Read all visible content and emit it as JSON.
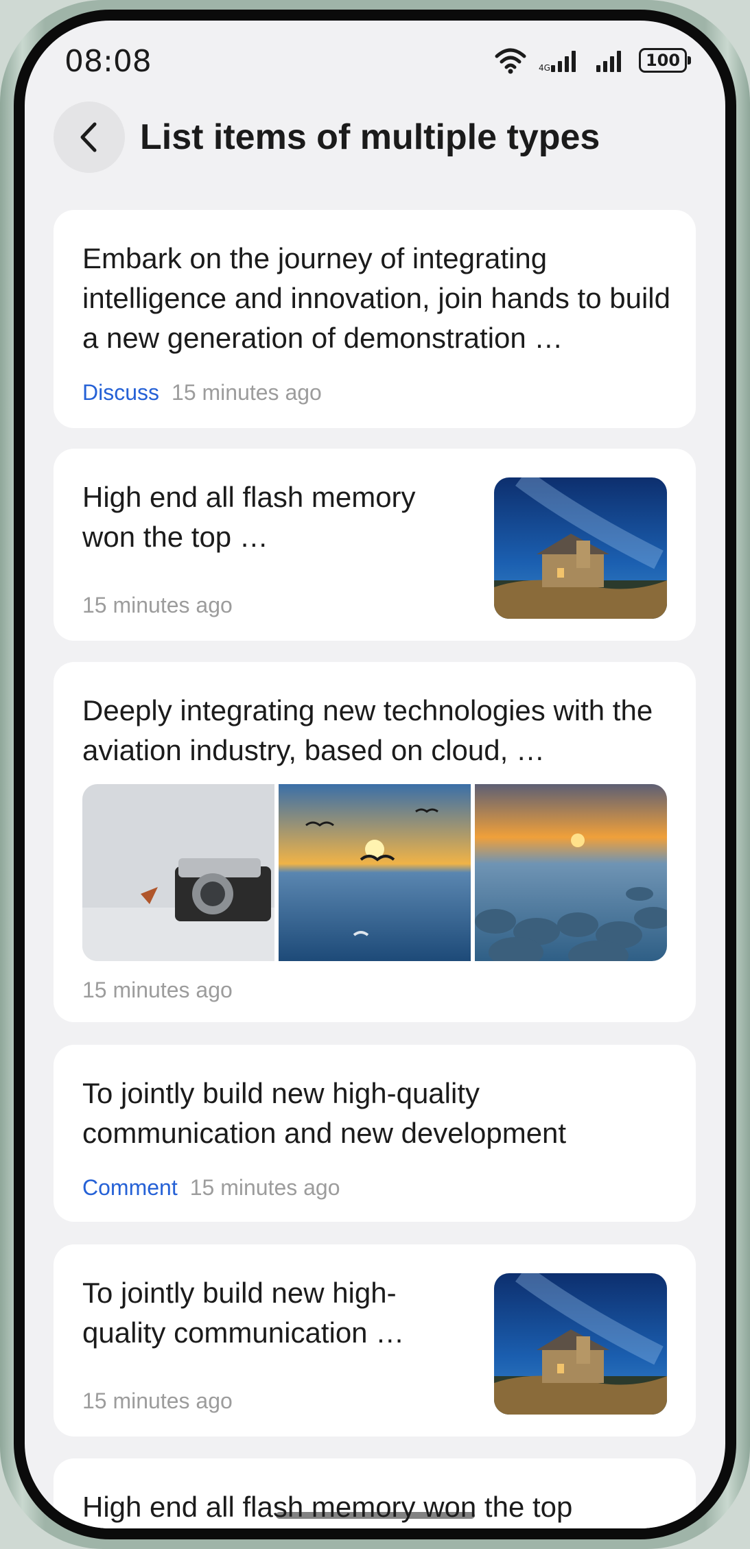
{
  "status_bar": {
    "time": "08:08",
    "battery": "100"
  },
  "header": {
    "title": "List items of multiple types"
  },
  "items": [
    {
      "title": "Embark on the journey of integrating intelligence and innovation, join hands to build a new generation of demonstration …",
      "tag": "Discuss",
      "time": "15 minutes ago"
    },
    {
      "title": "High end all flash memory won the top …",
      "time": "15 minutes ago"
    },
    {
      "title": "Deeply integrating new technologies with the aviation industry, based on cloud, …",
      "time": "15 minutes ago"
    },
    {
      "title": "To jointly build new high-quality communication and new development",
      "tag": "Comment",
      "time": "15 minutes ago"
    },
    {
      "title": "To jointly build new high-quality communication …",
      "time": "15 minutes ago"
    },
    {
      "title": "High end all flash memory won the top"
    }
  ],
  "colors": {
    "accent": "#2561d6",
    "background": "#f1f1f3",
    "card": "#ffffff",
    "meta_text": "#9c9c9c"
  }
}
